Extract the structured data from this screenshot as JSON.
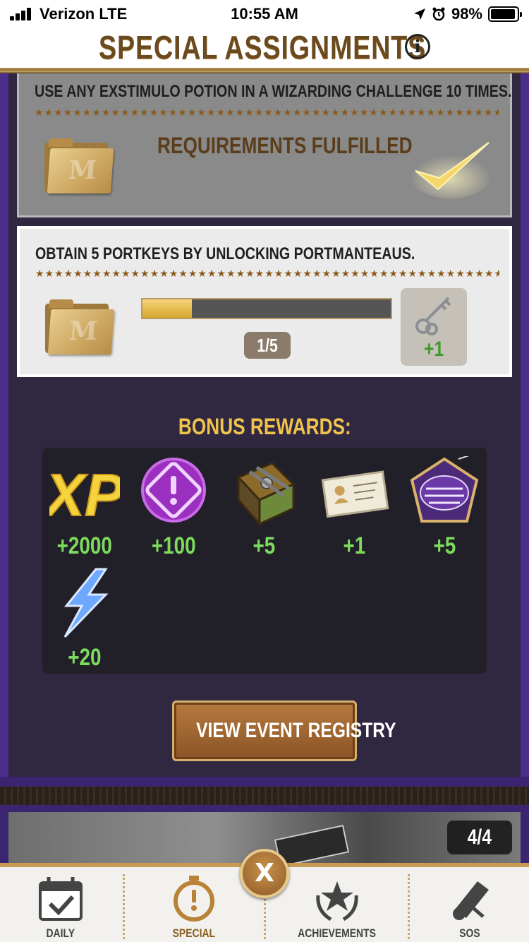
{
  "status_bar": {
    "carrier": "Verizon  LTE",
    "time": "10:55 AM",
    "battery": "98%"
  },
  "header": {
    "title": "SPECIAL ASSIGNMENTS",
    "info_icon": "info-icon"
  },
  "tasks": [
    {
      "text": "USE ANY EXSTIMULO POTION IN A WIZARDING CHALLENGE 10 TIMES.",
      "status": "REQUIREMENTS FULFILLED",
      "icon": "folder-icon",
      "check_icon": "checkmark-icon"
    },
    {
      "text": "OBTAIN 5 PORTKEYS BY UNLOCKING PORTMANTEAUS.",
      "progress": 0.2,
      "count": "1/5",
      "reward_icon": "portkey-icon",
      "reward_qty": "+1",
      "icon": "folder-icon"
    }
  ],
  "bonus": {
    "title": "BONUS REWARDS:",
    "items": [
      {
        "icon": "xp-icon",
        "value": "+2000"
      },
      {
        "icon": "attention-badge-icon",
        "value": "+100"
      },
      {
        "icon": "book-icon",
        "value": "+5"
      },
      {
        "icon": "card-icon",
        "value": "+1"
      },
      {
        "icon": "potion-shop-icon",
        "value": "+5"
      },
      {
        "icon": "energy-icon",
        "value": "+20"
      }
    ]
  },
  "registry_button": "VIEW EVENT REGISTRY",
  "pager": "4/4",
  "tabs": [
    {
      "label": "DAILY",
      "icon": "calendar-check-icon"
    },
    {
      "label": "SPECIAL",
      "icon": "stopwatch-icon",
      "active": true
    },
    {
      "label": "ACHIEVEMENTS",
      "icon": "laurel-star-icon"
    },
    {
      "label": "SOS",
      "icon": "scroll-icon"
    }
  ],
  "close_button": "X",
  "colors": {
    "gold": "#f1c34c",
    "reward_green": "#7ddb5c",
    "panel_purple": "#4d2d8c",
    "title_brown": "#6b4a1f"
  }
}
